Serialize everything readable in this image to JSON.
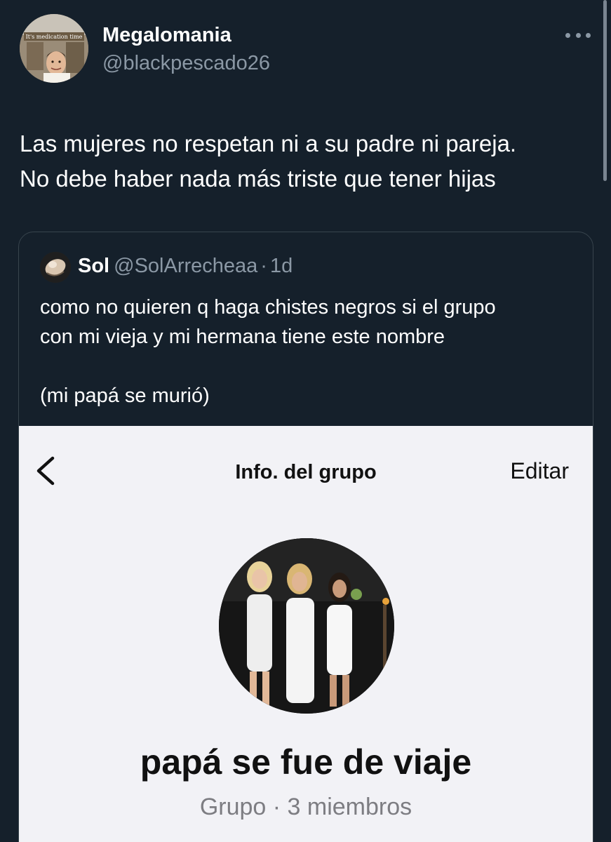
{
  "tweet": {
    "author": {
      "display_name": "Megalomania",
      "handle": "@blackpescado26",
      "avatar_caption": "It's medication time"
    },
    "text_lines": [
      "Las mujeres no respetan ni a su padre ni pareja.",
      "No debe haber nada más triste que tener hijas"
    ]
  },
  "quote": {
    "author": {
      "display_name": "Sol",
      "handle": "@SolArrecheaa",
      "separator": "·",
      "time": "1d"
    },
    "text_lines": [
      "como no quieren q haga chistes negros si el grupo",
      "con mi vieja y mi hermana tiene este nombre",
      "",
      "(mi papá se murió)"
    ],
    "media": {
      "nav_title": "Info. del grupo",
      "edit_label": "Editar",
      "group_name": "papá se fue de viaje",
      "group_subtitle": "Grupo · 3 miembros"
    }
  },
  "colors": {
    "background": "#15202b",
    "primary_text": "#ffffff",
    "secondary_text": "#8b98a5",
    "card_border": "#38444d",
    "media_background": "#f2f2f6"
  },
  "icons": [
    "more-horizontal-icon",
    "back-chevron-icon"
  ]
}
